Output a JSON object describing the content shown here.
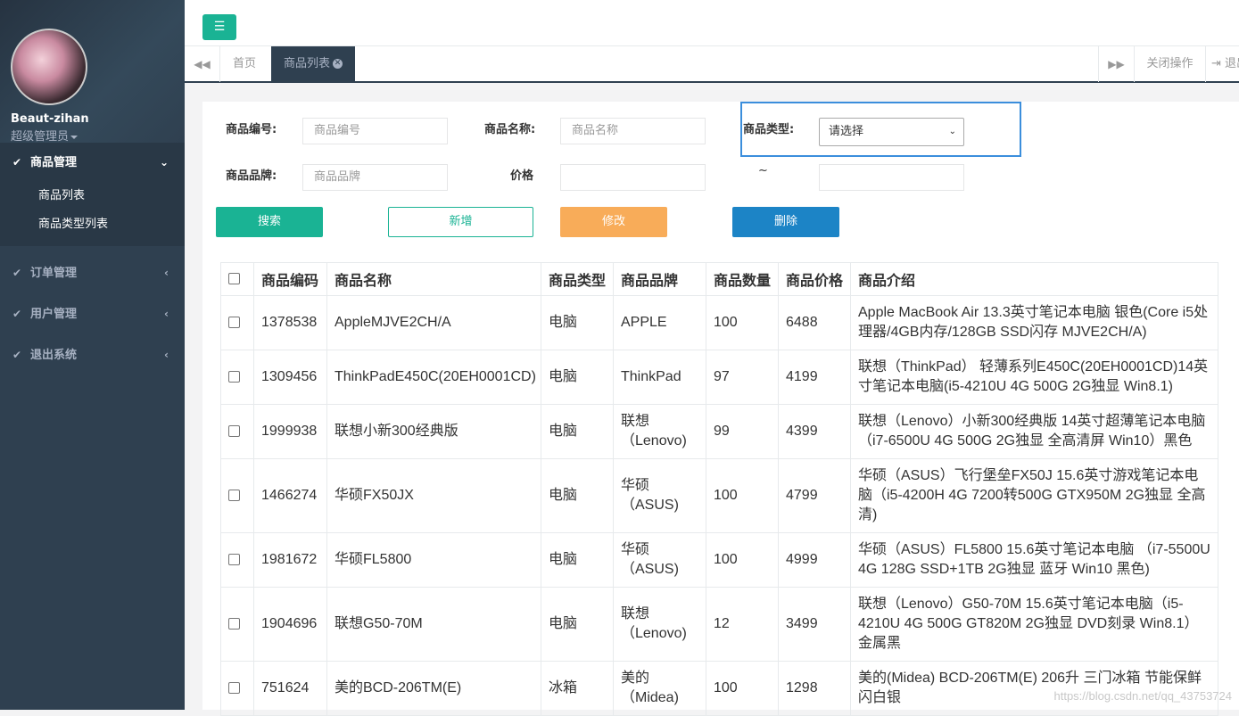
{
  "sidebar": {
    "username": "Beaut-zihan",
    "role": "超级管理员",
    "menus": [
      {
        "label": "商品管理",
        "subitems": [
          "商品列表",
          "商品类型列表"
        ]
      },
      {
        "label": "订单管理"
      },
      {
        "label": "用户管理"
      },
      {
        "label": "退出系统"
      }
    ]
  },
  "tabs": {
    "home": "首页",
    "active": "商品列表",
    "close_ops": "关闭操作",
    "logout": "退出"
  },
  "form": {
    "code_label": "商品编号:",
    "code_placeholder": "商品编号",
    "name_label": "商品名称:",
    "name_placeholder": "商品名称",
    "type_label": "商品类型:",
    "type_selected": "请选择",
    "brand_label": "商品品牌:",
    "brand_placeholder": "商品品牌",
    "price_label": "价格",
    "tilde": "~",
    "search_btn": "搜索",
    "add_btn": "新增",
    "edit_btn": "修改",
    "delete_btn": "删除"
  },
  "table": {
    "headers": [
      "商品编码",
      "商品名称",
      "商品类型",
      "商品品牌",
      "商品数量",
      "商品价格",
      "商品介绍"
    ],
    "rows": [
      [
        "1378538",
        "AppleMJVE2CH/A",
        "电脑",
        "APPLE",
        "100",
        "6488",
        "Apple MacBook Air 13.3英寸笔记本电脑 银色(Core i5处理器/4GB内存/128GB SSD闪存 MJVE2CH/A)"
      ],
      [
        "1309456",
        "ThinkPadE450C(20EH0001CD)",
        "电脑",
        "ThinkPad",
        "97",
        "4199",
        "联想（ThinkPad） 轻薄系列E450C(20EH0001CD)14英寸笔记本电脑(i5-4210U 4G 500G 2G独显 Win8.1)"
      ],
      [
        "1999938",
        "联想小新300经典版",
        "电脑",
        "联想（Lenovo)",
        "99",
        "4399",
        "联想（Lenovo）小新300经典版 14英寸超薄笔记本电脑（i7-6500U 4G 500G 2G独显 全高清屏 Win10）黑色"
      ],
      [
        "1466274",
        "华硕FX50JX",
        "电脑",
        "华硕（ASUS)",
        "100",
        "4799",
        "华硕（ASUS）飞行堡垒FX50J 15.6英寸游戏笔记本电脑（i5-4200H 4G 7200转500G GTX950M 2G独显 全高清)"
      ],
      [
        "1981672",
        "华硕FL5800",
        "电脑",
        "华硕（ASUS)",
        "100",
        "4999",
        "华硕（ASUS）FL5800 15.6英寸笔记本电脑 （i7-5500U 4G 128G SSD+1TB 2G独显 蓝牙 Win10 黑色)"
      ],
      [
        "1904696",
        "联想G50-70M",
        "电脑",
        "联想（Lenovo)",
        "12",
        "3499",
        "联想（Lenovo）G50-70M 15.6英寸笔记本电脑（i5-4210U 4G 500G GT820M 2G独显 DVD刻录 Win8.1）金属黑"
      ],
      [
        "751624",
        "美的BCD-206TM(E)",
        "冰箱",
        "美的（Midea)",
        "100",
        "1298",
        "美的(Midea) BCD-206TM(E) 206升 三门冰箱 节能保鲜 闪白银"
      ]
    ]
  },
  "watermark": "https://blog.csdn.net/qq_43753724"
}
